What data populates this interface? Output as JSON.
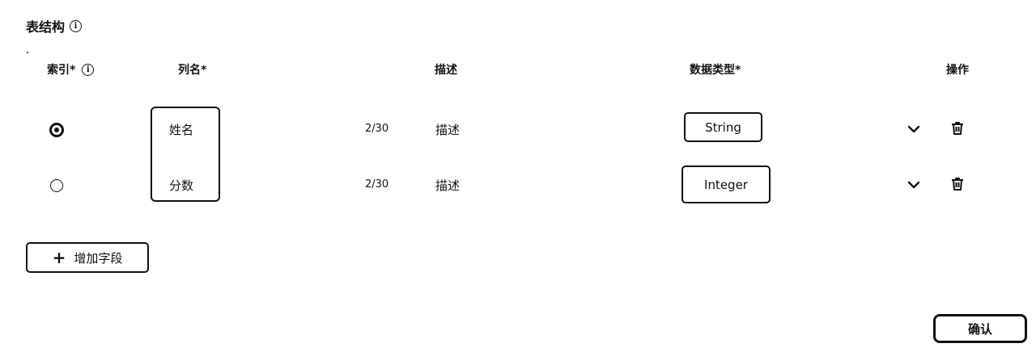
{
  "section": {
    "title": "表结构"
  },
  "headers": {
    "index": "索引*",
    "column_name": "列名*",
    "description": "描述",
    "data_type": "数据类型*",
    "actions": "操作"
  },
  "rows": [
    {
      "index_selected": true,
      "name": "姓名",
      "counter": "2/30",
      "description": "描述",
      "type": "String"
    },
    {
      "index_selected": false,
      "name": "分数",
      "counter": "2/30",
      "description": "描述",
      "type": "Integer"
    }
  ],
  "buttons": {
    "add_field": "增加字段",
    "confirm": "确认"
  },
  "icons": {
    "info": "info-icon",
    "expand": "chevron-down-icon",
    "delete": "trash-icon",
    "add": "plus-icon"
  }
}
